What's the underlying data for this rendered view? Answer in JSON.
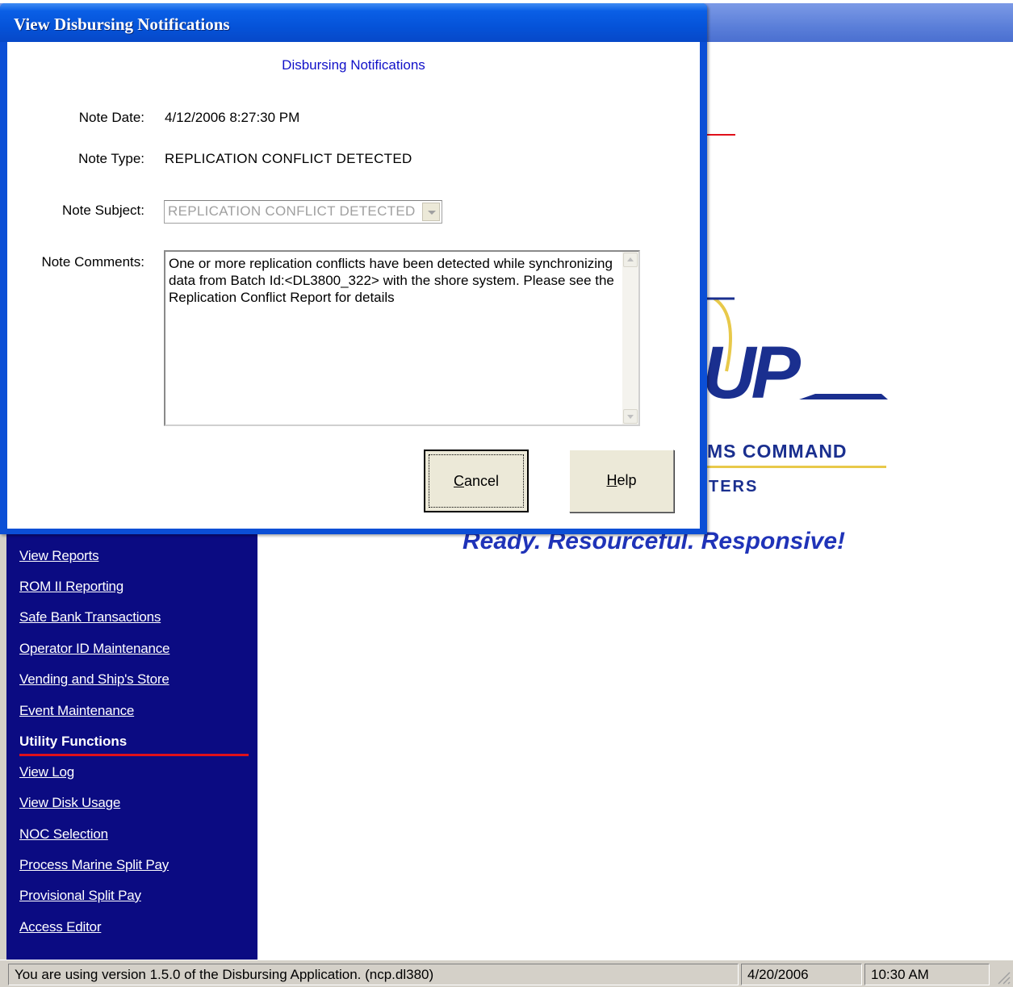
{
  "dialog": {
    "title": "View Disbursing Notifications",
    "heading": "Disbursing Notifications",
    "note_date_label": "Note Date:",
    "note_date_value": "4/12/2006 8:27:30 PM",
    "note_type_label": "Note Type:",
    "note_type_value": "REPLICATION CONFLICT DETECTED",
    "note_subject_label": "Note Subject:",
    "note_subject_value": "REPLICATION CONFLICT DETECTED",
    "note_comments_label": "Note Comments:",
    "note_comments_value": "One or more replication conflicts have been detected while synchronizing data from Batch Id:<DL3800_322> with the shore system. Please see the Replication Conflict Report for details",
    "cancel_button": {
      "accel": "C",
      "rest": "ancel"
    },
    "help_button": {
      "accel": "H",
      "rest": "elp"
    }
  },
  "sidebar": {
    "items_top": [
      "View Reports",
      "ROM II Reporting",
      "Safe Bank Transactions",
      "Operator ID Maintenance",
      "Vending and Ship's Store",
      "Event Maintenance"
    ],
    "section_heading": "Utility Functions",
    "items_bottom": [
      "View Log",
      "View Disk Usage",
      "NOC Selection",
      "Process Marine Split Pay",
      "Provisional Split Pay",
      "Access Editor"
    ]
  },
  "branding": {
    "logo_text": "UP",
    "org_line1": "MS COMMAND",
    "org_line2": "TERS",
    "tagline": "Ready. Resourceful. Responsive!",
    "brand_color": "#1a2f8f",
    "accent_color": "#e0101a"
  },
  "statusbar": {
    "message": "You are using version 1.5.0  of the Disbursing Application. (ncp.dl380)",
    "date": "4/20/2006",
    "time": "10:30 AM"
  }
}
